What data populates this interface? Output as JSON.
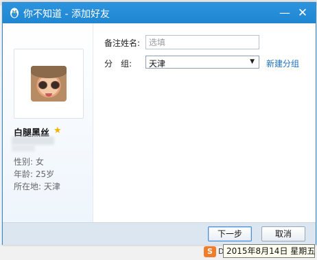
{
  "window": {
    "title": "你不知道 - 添加好友",
    "minimize_symbol": "—",
    "close_symbol": "✕",
    "title_icon": "qq-penguin-icon"
  },
  "profile": {
    "nickname": "白腿黑丝",
    "gender_line": "性别: 女",
    "age_line": "年龄: 25岁",
    "location_line": "所在地:  天津",
    "badge_icon": "star-icon"
  },
  "form": {
    "remark_label": "备注姓名:",
    "remark_placeholder": "选填",
    "group_label": "分　组:",
    "group_value": "天津",
    "new_group_link": "新建分组"
  },
  "footer": {
    "next_label": "下一步",
    "cancel_label": "取消"
  },
  "taskbar": {
    "tray_icon_label": "S",
    "tray_letter": "D",
    "date_tooltip": "2015年8月14日 星期五"
  },
  "colors": {
    "titlebar": "#1f86d2",
    "link": "#1d6fbf",
    "footer": "#dbe6f1",
    "star": "#f0b400"
  }
}
